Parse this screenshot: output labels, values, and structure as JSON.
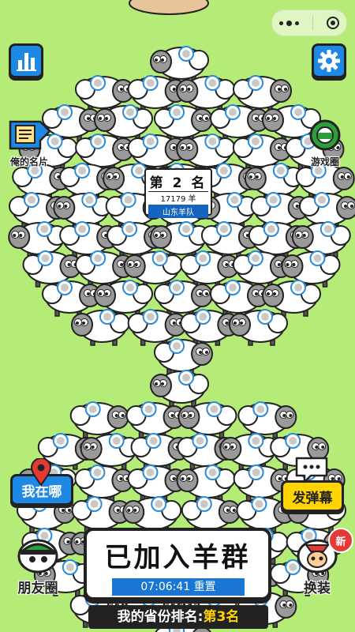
{
  "top_left": {
    "rank_button_icon": "bar-chart-icon"
  },
  "top_right": {
    "settings_icon": "gear-icon"
  },
  "left_side": {
    "name_card_label": "俺的名片"
  },
  "right_side": {
    "game_circle_label": "游戏圈"
  },
  "leader_card": {
    "rank_label": "第 2 名",
    "sheep_count": "17179 羊",
    "team_name": "山东羊队"
  },
  "actions": {
    "where_am_i": "我在哪",
    "send_danmaku": "发弹幕",
    "friends_circle": "朋友圈",
    "change_outfit": "换装",
    "new_badge": "新"
  },
  "join_panel": {
    "title": "已加入羊群",
    "timer": "07:06:41 重置"
  },
  "province_rank": {
    "prefix": "我的省份排名:",
    "rank": "第3名"
  },
  "colors": {
    "background": "#b5ec78",
    "blue": "#1e88e5",
    "yellow": "#ffd400",
    "red": "#e53935",
    "green": "#2e9d3a"
  }
}
